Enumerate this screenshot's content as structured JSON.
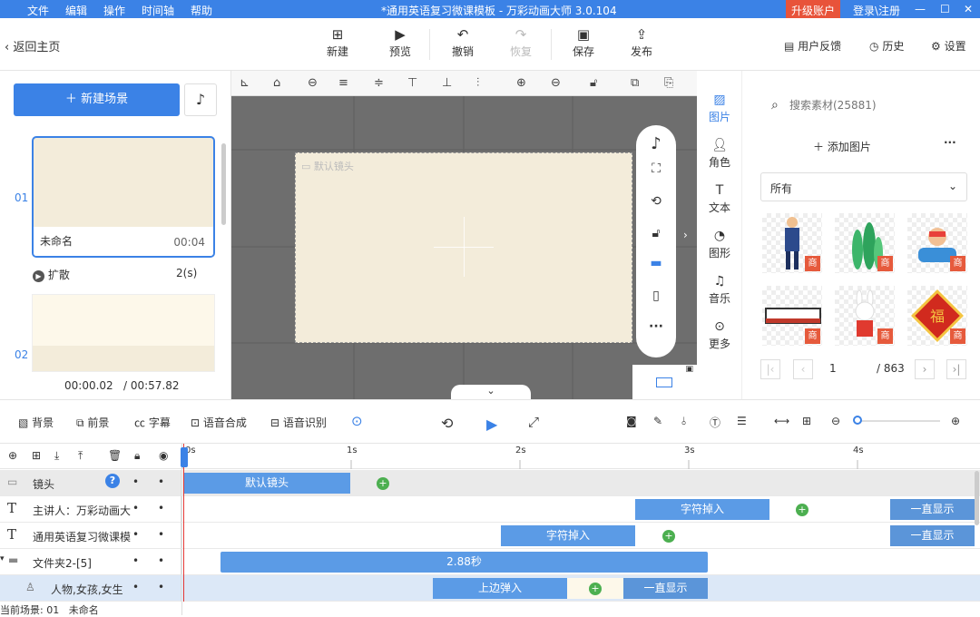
{
  "menu": [
    "文件",
    "编辑",
    "操作",
    "时间轴",
    "帮助"
  ],
  "window_title": "*通用英语复习微课模板 - 万彩动画大师 3.0.104",
  "upgrade": "升级账户",
  "login": "登录\\注册",
  "back": "返回主页",
  "toolbar": {
    "new": "新建",
    "preview": "预览",
    "undo": "撤销",
    "redo": "恢复",
    "save": "保存",
    "publish": "发布"
  },
  "feedback": "用户反馈",
  "history": "历史",
  "settings": "设置",
  "new_scene": "新建场景",
  "scenes": [
    {
      "num": "01",
      "name": "未命名",
      "duration": "00:04",
      "transition": "扩散",
      "trans_time": "2(s)"
    },
    {
      "num": "02"
    }
  ],
  "time_current": "00:00.02",
  "time_total": "/ 00:57.82",
  "stage_label": "默认镜头",
  "res_tabs": [
    "图片",
    "角色",
    "文本",
    "图形",
    "音乐",
    "更多"
  ],
  "search_placeholder": "搜索素材(25881)",
  "add_image": "添加图片",
  "filter": "所有",
  "page": {
    "current": "1",
    "total": "/ 863"
  },
  "shang": "商",
  "tl_tools": [
    "背景",
    "前景",
    "字幕",
    "语音合成",
    "语音识别"
  ],
  "ruler": [
    "0s",
    "1s",
    "2s",
    "3s",
    "4s"
  ],
  "tracks": [
    {
      "name": "镜头",
      "clips": [
        "默认镜头"
      ]
    },
    {
      "name": "主讲人：万彩动画大",
      "clips": [
        "字符掉入",
        "一直显示"
      ]
    },
    {
      "name": "通用英语复习微课模",
      "clips": [
        "字符掉入",
        "一直显示"
      ]
    },
    {
      "name": "文件夹2-[5]",
      "clips": [
        "2.88秒"
      ]
    },
    {
      "name": "人物,女孩,女生",
      "clips": [
        "上边弹入",
        "一直显示"
      ]
    }
  ],
  "status": "当前场景: 01   未命名"
}
